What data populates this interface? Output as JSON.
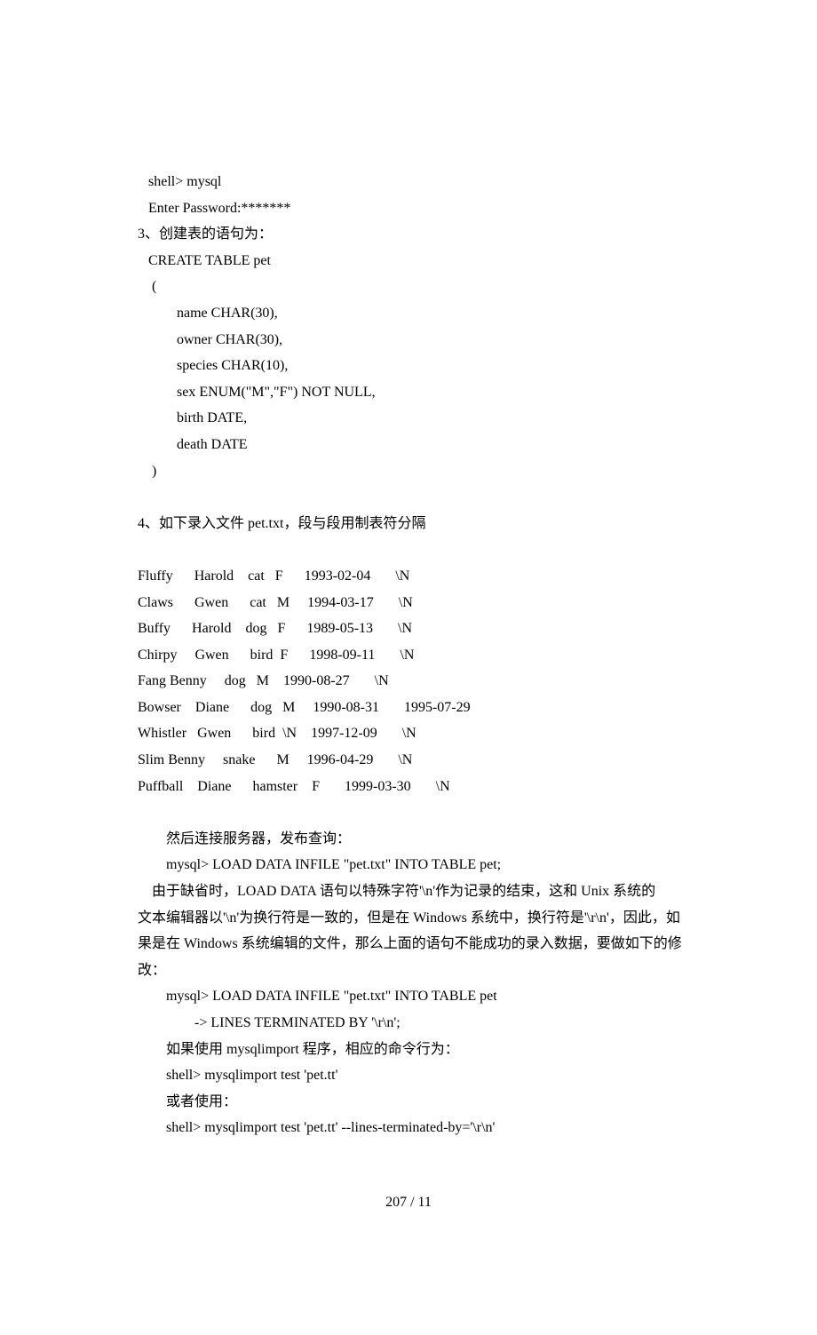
{
  "lines": {
    "l1": "   shell> mysql",
    "l2": "   Enter Password:*******",
    "l3": "3、创建表的语句为：",
    "l4": "   CREATE TABLE pet",
    "l5": "    (",
    "l6": "           name CHAR(30),",
    "l7": "           owner CHAR(30),",
    "l8": "           species CHAR(10),",
    "l9": "           sex ENUM(\"M\",\"F\") NOT NULL,",
    "l10": "           birth DATE,",
    "l11": "           death DATE",
    "l12": "    )",
    "l13": "",
    "l14": "4、如下录入文件 pet.txt，段与段用制表符分隔",
    "l15": "",
    "l16": "Fluffy      Harold    cat   F      1993-02-04       \\N",
    "l17": "Claws      Gwen      cat   M     1994-03-17       \\N",
    "l18": "Buffy      Harold    dog   F      1989-05-13       \\N",
    "l19": "Chirpy     Gwen      bird  F      1998-09-11       \\N",
    "l20": "Fang Benny     dog   M    1990-08-27       \\N",
    "l21": "Bowser    Diane      dog   M     1990-08-31       1995-07-29",
    "l22": "Whistler   Gwen      bird  \\N    1997-12-09       \\N",
    "l23": "Slim Benny     snake      M     1996-04-29       \\N",
    "l24": "Puffball    Diane      hamster    F       1999-03-30       \\N",
    "l25": "",
    "l26": "然后连接服务器，发布查询：",
    "l27": "mysql> LOAD DATA INFILE \"pet.txt\" INTO TABLE pet;",
    "l28": "    由于缺省时，LOAD DATA 语句以特殊字符'\\n'作为记录的结束，这和 Unix 系统的",
    "l29": "文本编辑器以'\\n'为换行符是一致的，但是在 Windows 系统中，换行符是'\\r\\n'，因此，如",
    "l30": "果是在 Windows 系统编辑的文件，那么上面的语句不能成功的录入数据，要做如下的修",
    "l31": "改：",
    "l32": "mysql> LOAD DATA INFILE \"pet.txt\" INTO TABLE pet",
    "l33": "        -> LINES TERMINATED BY '\\r\\n';",
    "l34": "如果使用 mysqlimport 程序，相应的命令行为：",
    "l35": "shell> mysqlimport test 'pet.tt'",
    "l36": "或者使用：",
    "l37": "shell> mysqlimport test 'pet.tt' --lines-terminated-by='\\r\\n'"
  },
  "footer": "207  / 11"
}
